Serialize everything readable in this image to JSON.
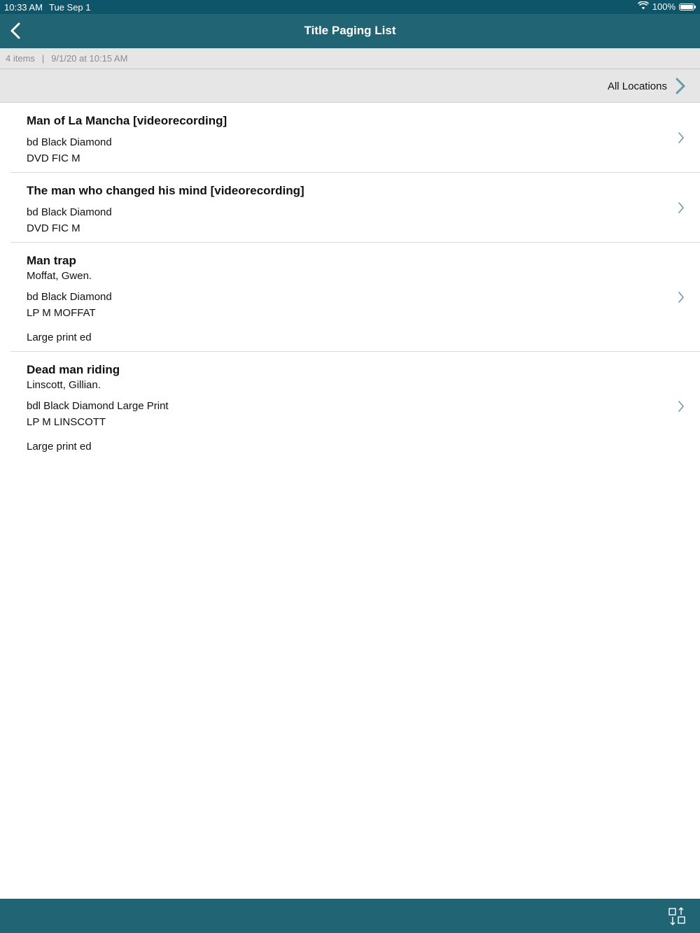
{
  "status_bar": {
    "time": "10:33 AM",
    "date": "Tue Sep 1",
    "battery": "100%",
    "battery_level": 1.0,
    "wifi_icon": "wifi-icon"
  },
  "nav": {
    "title": "Title Paging List",
    "back_icon": "chevron-left-icon"
  },
  "info": {
    "count": "4 items",
    "separator": "|",
    "timestamp": "9/1/20 at 10:15 AM"
  },
  "location": {
    "label": "All Locations",
    "icon": "chevron-right-icon"
  },
  "items": [
    {
      "title": "Man of La Mancha [videorecording]",
      "author": "",
      "location": "bd Black Diamond",
      "call_number": "DVD FIC M",
      "edition": ""
    },
    {
      "title": "The man who changed his mind [videorecording]",
      "author": "",
      "location": "bd Black Diamond",
      "call_number": "DVD FIC M",
      "edition": ""
    },
    {
      "title": "Man trap",
      "author": "Moffat, Gwen.",
      "location": "bd Black Diamond",
      "call_number": "LP M MOFFAT",
      "edition": "Large print ed"
    },
    {
      "title": "Dead man riding",
      "author": "Linscott, Gillian.",
      "location": "bdl Black Diamond Large Print",
      "call_number": "LP M LINSCOTT",
      "edition": "Large print ed"
    }
  ],
  "toolbar": {
    "sort_icon": "sort-icon"
  },
  "colors": {
    "status_bar": "#0f5569",
    "nav_bar": "#216574",
    "header_bg": "#e6e6e6",
    "chevron": "#6a9aaa"
  }
}
